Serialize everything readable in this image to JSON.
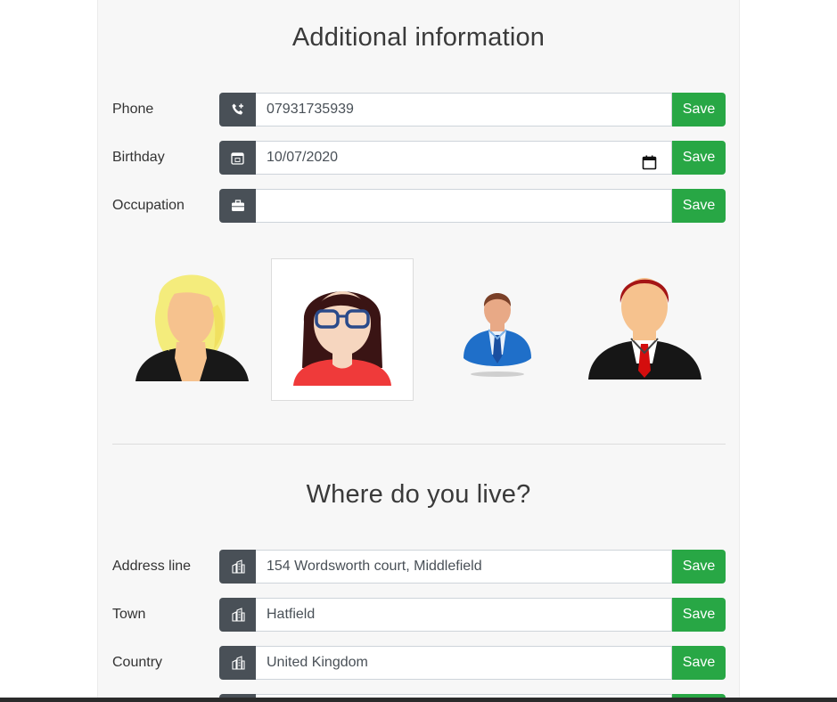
{
  "additional": {
    "title": "Additional information",
    "fields": [
      {
        "label": "Phone",
        "value": "07931735939",
        "icon": "phone-icon",
        "save": "Save"
      },
      {
        "label": "Birthday",
        "value": "10/07/2020",
        "icon": "calendar-icon",
        "save": "Save"
      },
      {
        "label": "Occupation",
        "value": "",
        "icon": "briefcase-icon",
        "save": "Save"
      }
    ]
  },
  "avatars": [
    {
      "name": "avatar-blonde-woman",
      "selected": false
    },
    {
      "name": "avatar-woman-glasses",
      "selected": true
    },
    {
      "name": "avatar-man-blue-suit",
      "selected": false
    },
    {
      "name": "avatar-man-red-tie",
      "selected": false
    }
  ],
  "live": {
    "title": "Where do you live?",
    "fields": [
      {
        "label": "Address line",
        "value": "154 Wordsworth court, Middlefield",
        "icon": "building-icon",
        "save": "Save"
      },
      {
        "label": "Town",
        "value": "Hatfield",
        "icon": "building-icon",
        "save": "Save"
      },
      {
        "label": "Country",
        "value": "United Kingdom",
        "icon": "building-icon",
        "save": "Save"
      }
    ]
  },
  "colors": {
    "save": "#28a745",
    "addon": "#495057",
    "panel": "#f7f7f7"
  }
}
